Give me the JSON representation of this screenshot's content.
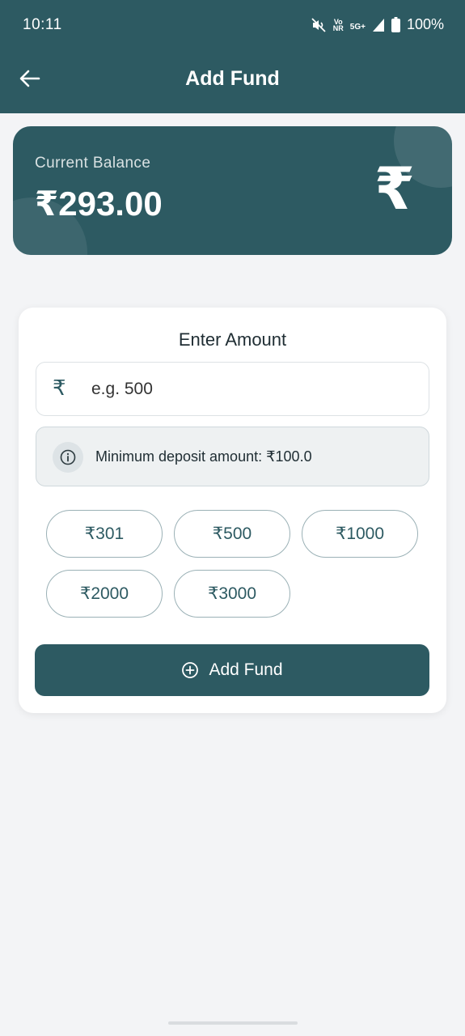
{
  "status_bar": {
    "time": "10:11",
    "network_top": "Vo",
    "network_bottom": "NR",
    "network_type": "5G+",
    "battery": "100%"
  },
  "app_bar": {
    "title": "Add Fund",
    "back_icon": "arrow-left-icon"
  },
  "balance_card": {
    "label": "Current Balance",
    "value": "₹293.00",
    "currency_symbol": "₹"
  },
  "form": {
    "title": "Enter Amount",
    "input_prefix": "₹",
    "input_placeholder": "e.g. 500",
    "input_value": "",
    "min_notice": "Minimum deposit amount: ₹100.0",
    "quick_amounts": [
      "₹301",
      "₹500",
      "₹1000",
      "₹2000",
      "₹3000"
    ],
    "submit_label": "Add Fund",
    "submit_icon": "plus-circle-icon"
  },
  "colors": {
    "primary": "#2d5a62",
    "background": "#f3f4f6",
    "card": "#ffffff",
    "chip_border": "#9bb1b6"
  }
}
